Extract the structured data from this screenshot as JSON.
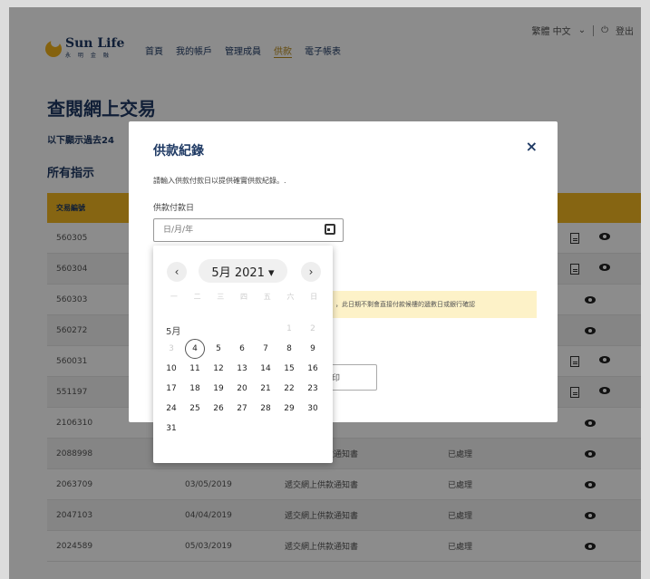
{
  "header": {
    "logo_text": "Sun Life",
    "logo_sub": "永 明 金 融",
    "nav": [
      "首頁",
      "我的帳戶",
      "管理成員",
      "供款",
      "電子帳表"
    ],
    "lang": "繁體 中文",
    "logout": "登出"
  },
  "page": {
    "title": "查閱網上交易",
    "subinfo": "以下顯示過去24",
    "section": "所有指示"
  },
  "table": {
    "header": [
      "交易編號",
      "",
      "",
      "",
      ""
    ],
    "rows": [
      [
        "560305",
        "",
        "",
        "",
        "doc|eye"
      ],
      [
        "560304",
        "",
        "",
        "",
        "doc|eye"
      ],
      [
        "560303",
        "",
        "",
        "",
        "eye"
      ],
      [
        "560272",
        "",
        "",
        "",
        "eye"
      ],
      [
        "560031",
        "",
        "",
        "",
        "doc|eye"
      ],
      [
        "551197",
        "",
        "",
        "",
        "doc|eye"
      ],
      [
        "2106310",
        "",
        "",
        "",
        "eye"
      ],
      [
        "2088998",
        "",
        "遞交網上供款通知書",
        "已處理",
        "eye"
      ],
      [
        "2063709",
        "03/05/2019",
        "遞交網上供款通知書",
        "已處理",
        "eye"
      ],
      [
        "2047103",
        "04/04/2019",
        "遞交網上供款通知書",
        "已處理",
        "eye"
      ],
      [
        "2024589",
        "05/03/2019",
        "遞交網上供款通知書",
        "已處理",
        "eye"
      ]
    ]
  },
  "modal": {
    "title": "供款紀錄",
    "close": "×",
    "desc": "請輸入供款付款日以提供確實供款紀錄。.",
    "field_label": "供款付款日",
    "placeholder": "日/月/年",
    "warning": "，此日期不剩會直接付款候樓的遞數日或銀行確認",
    "print_label": "列印"
  },
  "calendar": {
    "prev": "‹",
    "next": "›",
    "month_label": "5月 2021 ▾",
    "weekdays": [
      "一",
      "二",
      "三",
      "四",
      "五",
      "六",
      "日"
    ],
    "month_short": "5月",
    "days": [
      [
        "",
        "",
        "",
        "",
        "",
        "1",
        "2"
      ],
      [
        "3",
        "4",
        "5",
        "6",
        "7",
        "8",
        "9"
      ],
      [
        "10",
        "11",
        "12",
        "13",
        "14",
        "15",
        "16"
      ],
      [
        "17",
        "18",
        "19",
        "20",
        "21",
        "22",
        "23"
      ],
      [
        "24",
        "25",
        "26",
        "27",
        "28",
        "29",
        "30"
      ],
      [
        "31",
        "",
        "",
        "",
        "",
        "",
        ""
      ]
    ],
    "today": "4"
  }
}
